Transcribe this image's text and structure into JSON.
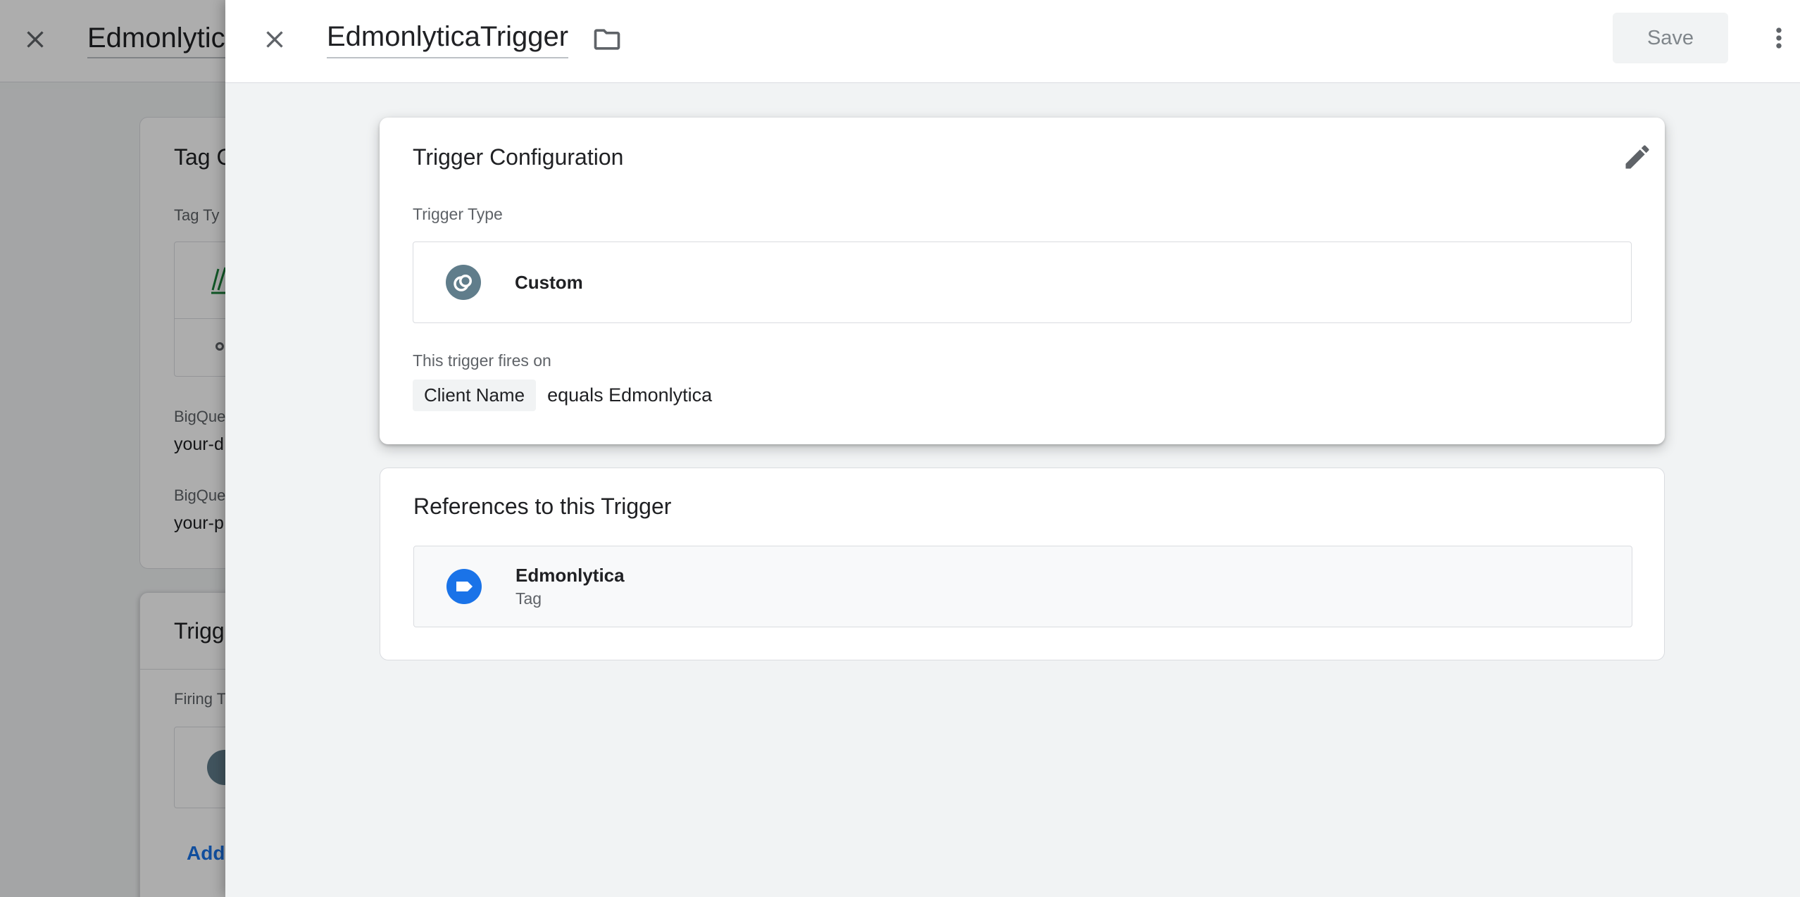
{
  "background": {
    "title": "Edmonlytica",
    "tag_config_title": "Tag C",
    "tag_type_label": "Tag Ty",
    "bigquery_label_1": "BigQue",
    "bigquery_value_1": "your-d",
    "bigquery_label_2": "BigQue",
    "bigquery_value_2": "your-p",
    "triggering_title": "Trigg",
    "firing_label": "Firing T",
    "add_link": "Add"
  },
  "panel": {
    "title": "EdmonlyticaTrigger",
    "save_label": "Save",
    "icons": {
      "close": "close-icon",
      "folder": "folder-icon",
      "more": "more-vert-icon",
      "edit": "pencil-icon"
    }
  },
  "trigger_config": {
    "title": "Trigger Configuration",
    "type_label": "Trigger Type",
    "type_name": "Custom",
    "type_icon": "custom-event-icon",
    "fires_on_label": "This trigger fires on",
    "condition": {
      "variable": "Client Name",
      "operator_value": "equals Edmonlytica"
    }
  },
  "references": {
    "title": "References to this Trigger",
    "items": [
      {
        "name": "Edmonlytica",
        "type": "Tag",
        "icon": "tag-icon"
      }
    ]
  },
  "colors": {
    "accent_blue": "#1a73e8",
    "trigger_icon_gray": "#607d8b",
    "text_primary": "#202124",
    "text_secondary": "#5f6368"
  }
}
